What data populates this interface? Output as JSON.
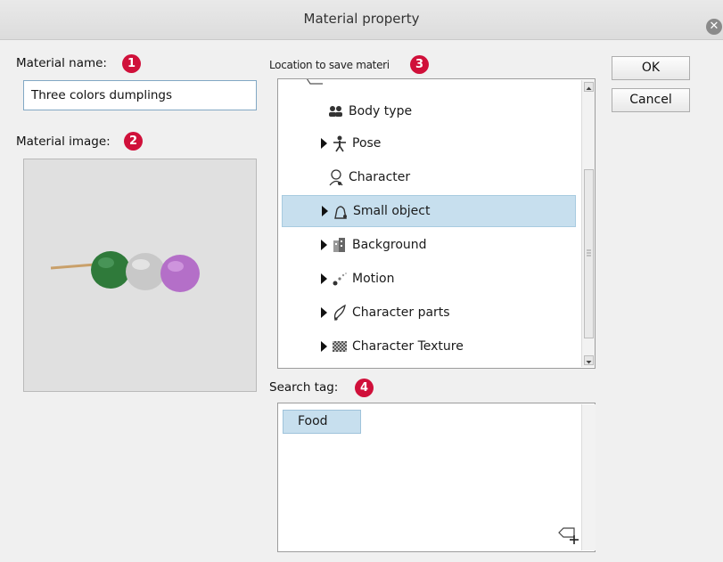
{
  "dialog": {
    "title": "Material property",
    "close_icon": "close-icon"
  },
  "material_name": {
    "label": "Material name:",
    "badge": "1",
    "value": "Three colors dumplings"
  },
  "material_image": {
    "label": "Material image:",
    "badge": "2"
  },
  "location": {
    "label": "Location to save materi",
    "badge": "3",
    "items": [
      {
        "label": "Body type",
        "icon": "body-type-icon",
        "expandable": false,
        "selected": false
      },
      {
        "label": "Pose",
        "icon": "pose-icon",
        "expandable": true,
        "selected": false
      },
      {
        "label": "Character",
        "icon": "character-icon",
        "expandable": false,
        "selected": false
      },
      {
        "label": "Small object",
        "icon": "small-object-icon",
        "expandable": true,
        "selected": true
      },
      {
        "label": "Background",
        "icon": "background-icon",
        "expandable": true,
        "selected": false
      },
      {
        "label": "Motion",
        "icon": "motion-icon",
        "expandable": true,
        "selected": false
      },
      {
        "label": "Character parts",
        "icon": "character-parts-icon",
        "expandable": true,
        "selected": false
      },
      {
        "label": "Character Texture",
        "icon": "character-texture-icon",
        "expandable": true,
        "selected": false
      }
    ]
  },
  "buttons": {
    "ok": "OK",
    "cancel": "Cancel"
  },
  "search_tag": {
    "label": "Search tag:",
    "badge": "4",
    "tags": [
      "Food"
    ]
  },
  "colors": {
    "badge": "#d0103a",
    "selection": "#c7dfee",
    "dumpling_green": "#2f7a3a",
    "dumpling_white": "#c8c8c8",
    "dumpling_pink": "#b46fc8"
  }
}
